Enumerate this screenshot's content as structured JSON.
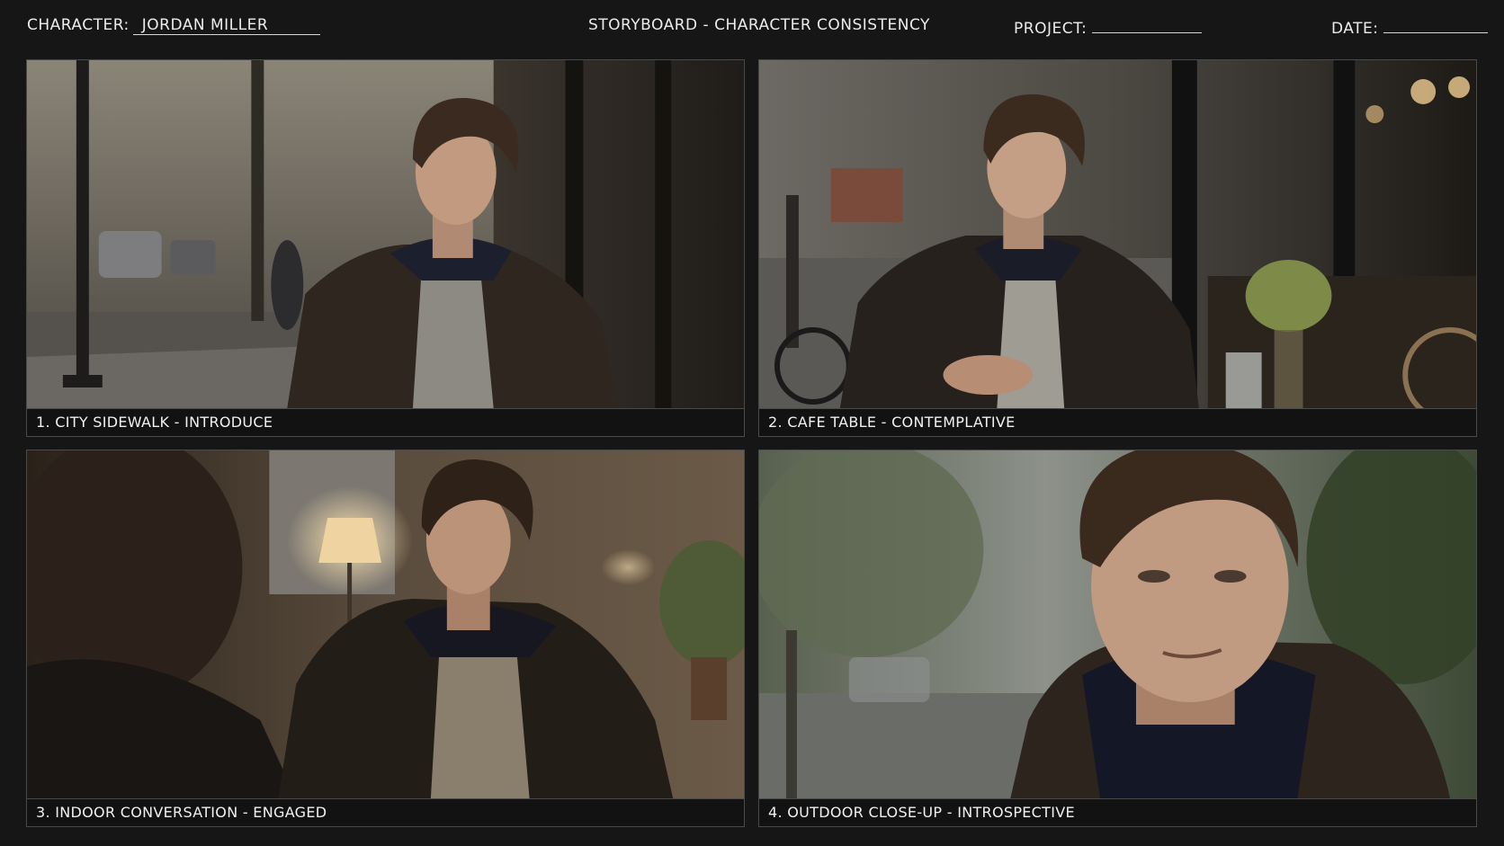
{
  "header": {
    "character_label": "CHARACTER:",
    "character_value": "JORDAN MILLER",
    "title": "STORYBOARD - CHARACTER CONSISTENCY",
    "project_label": "PROJECT:",
    "date_label": "DATE:"
  },
  "panels": [
    {
      "caption": "1. CITY SIDEWALK - INTRODUCE"
    },
    {
      "caption": "2. CAFE TABLE - CONTEMPLATIVE"
    },
    {
      "caption": "3. INDOOR CONVERSATION - ENGAGED"
    },
    {
      "caption": "4. OUTDOOR CLOSE-UP - INTROSPECTIVE"
    }
  ]
}
